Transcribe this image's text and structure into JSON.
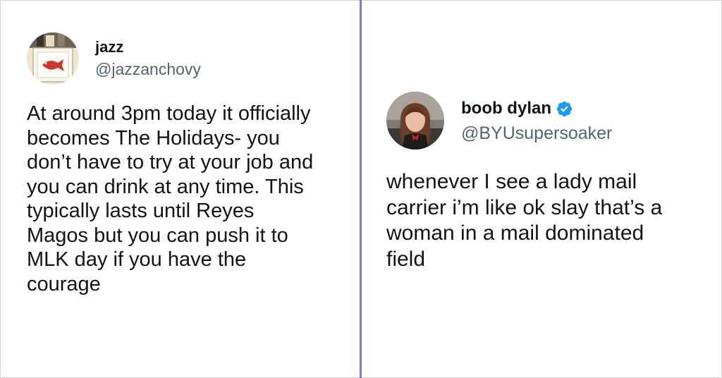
{
  "tweets": [
    {
      "display_name": "jazz",
      "handle": "@jazzanchovy",
      "verified": false,
      "avatar_icon": "fish-picture-avatar",
      "text": "At around 3pm today it officially\nbecomes The Holidays- you\ndon’t have to try at your job and\nyou can drink at any time. This\ntypically lasts until Reyes\nMagos but you can push it to\nMLK day if you have the\ncourage"
    },
    {
      "display_name": "boob dylan",
      "handle": "@BYUsupersoaker",
      "verified": true,
      "avatar_icon": "person-photo-avatar",
      "text": "whenever I see a lady mail\ncarrier i’m like ok slay that’s a\nwoman in a mail dominated\nfield"
    }
  ],
  "colors": {
    "divider": "#7b7bd6",
    "verified_badge": "#1d9bf0",
    "handle": "#536471",
    "text": "#0f1419"
  }
}
